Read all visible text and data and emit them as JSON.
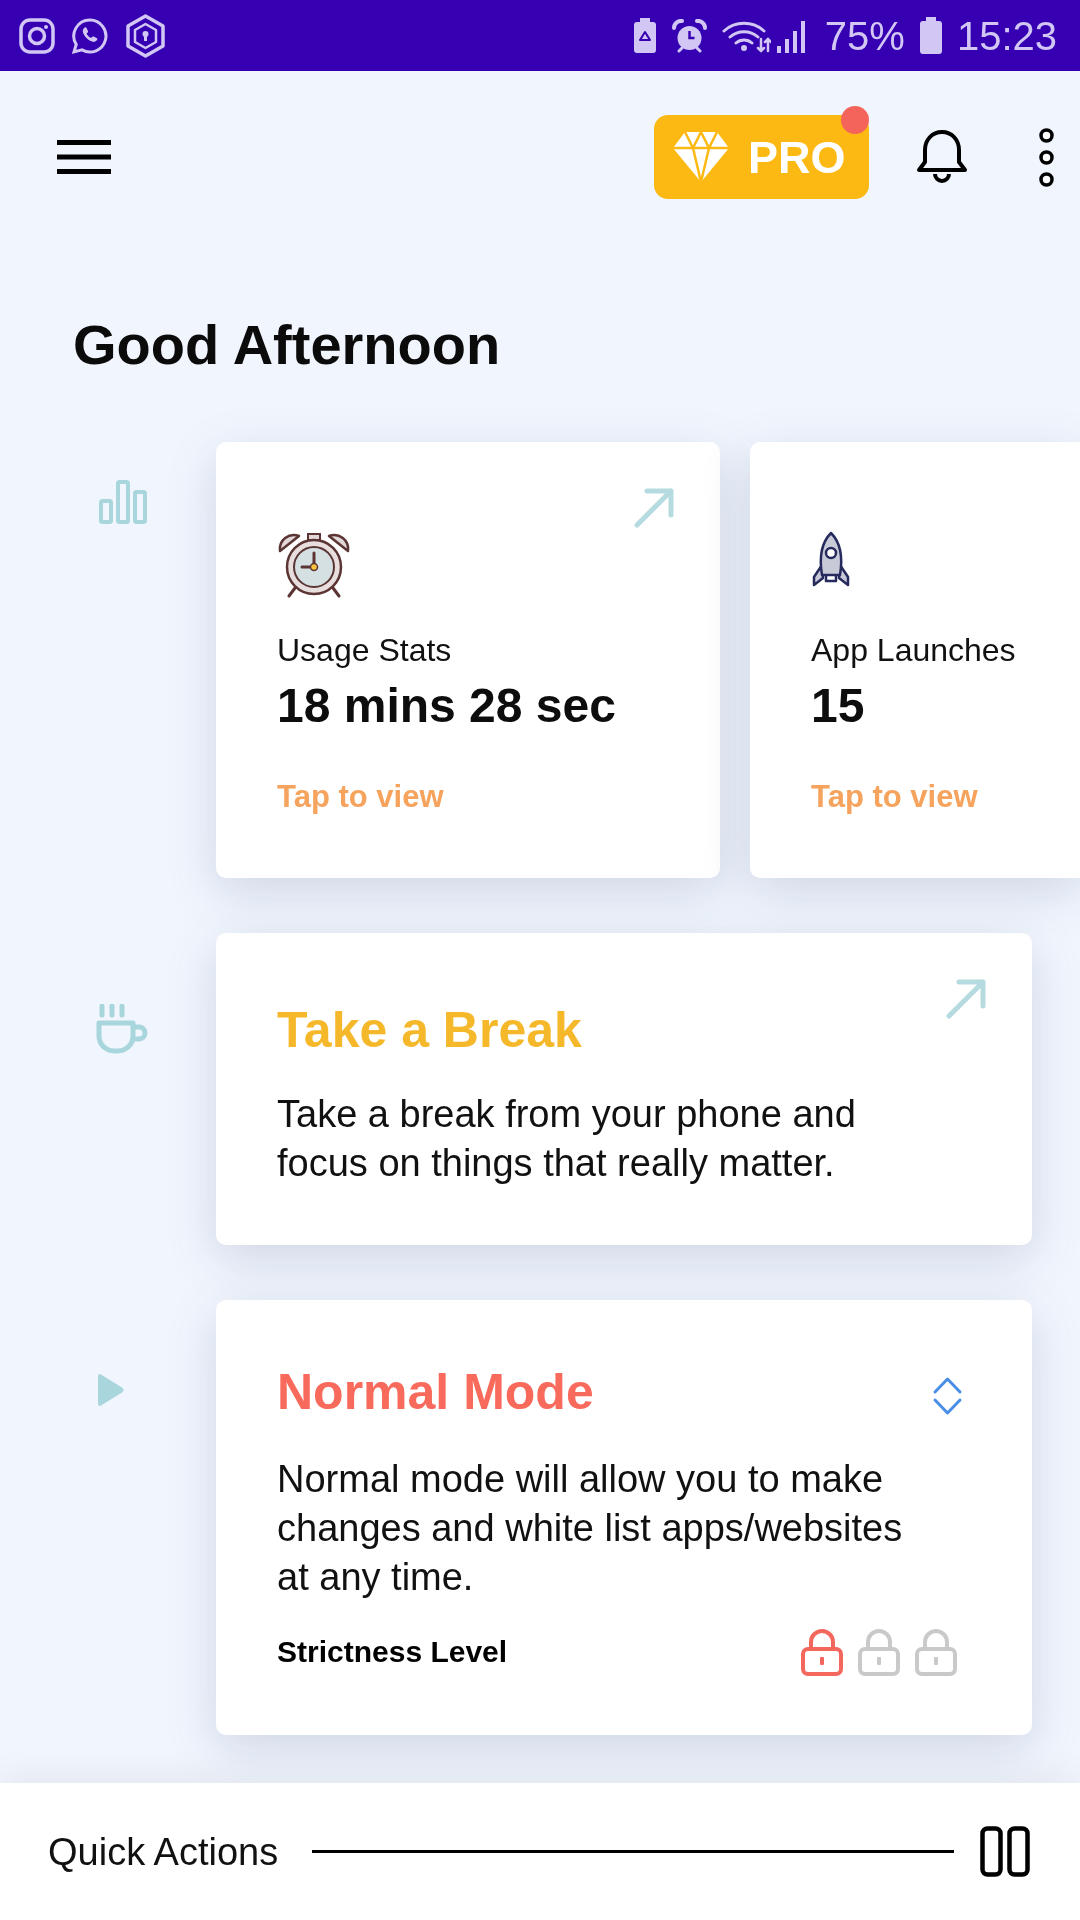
{
  "status_bar": {
    "battery": "75%",
    "time": "15:23"
  },
  "header": {
    "pro": {
      "label": "PRO",
      "notification": true
    }
  },
  "greeting": "Good Afternoon",
  "sections": [
    {
      "kind": "stats",
      "cards": [
        {
          "label": "Usage Stats",
          "value": "18 mins 28 sec",
          "link": "Tap to view",
          "arrow": true
        },
        {
          "label": "App Launches",
          "value": "15",
          "link": "Tap to view"
        }
      ]
    },
    {
      "kind": "break",
      "title": "Take a Break",
      "text": "Take a break from your phone and focus on things that really matter.",
      "arrow": true
    },
    {
      "kind": "mode",
      "title": "Normal Mode",
      "text": "Normal mode will allow you to make changes and white list apps/websites at any time.",
      "strictness_label": "Strictness Level",
      "locks": [
        {
          "active": true
        },
        {
          "active": false
        },
        {
          "active": false
        }
      ]
    }
  ],
  "quick_actions": {
    "label": "Quick Actions"
  }
}
